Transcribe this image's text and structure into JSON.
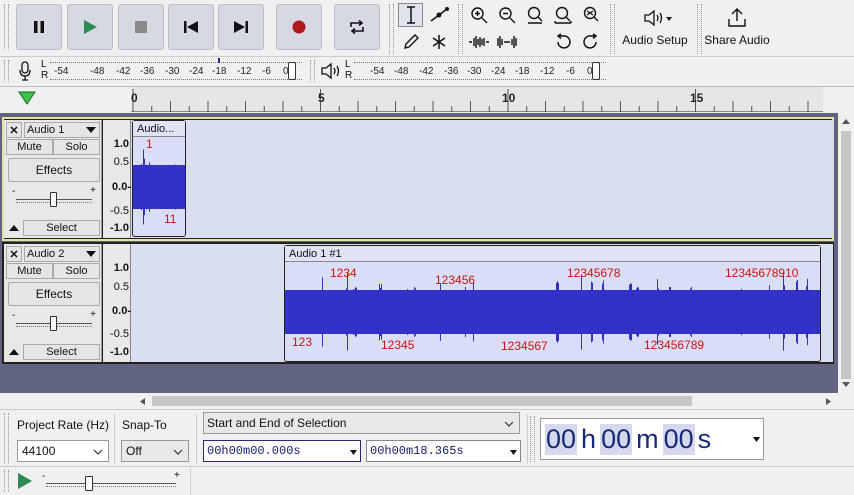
{
  "toolbar": {
    "transport": [
      {
        "name": "pause-button",
        "icon": "pause-icon"
      },
      {
        "name": "play-button",
        "icon": "play-icon"
      },
      {
        "name": "stop-button",
        "icon": "stop-icon"
      },
      {
        "name": "skip-start-button",
        "icon": "skip-start-icon"
      },
      {
        "name": "skip-end-button",
        "icon": "skip-end-icon"
      },
      {
        "name": "record-button",
        "icon": "record-icon"
      },
      {
        "name": "loop-button",
        "icon": "loop-icon"
      }
    ],
    "audio_setup_label": "Audio Setup",
    "share_audio_label": "Share Audio"
  },
  "meters": {
    "record_ticks": [
      "-54",
      "-48",
      "-42",
      "-36",
      "-30",
      "-24",
      "-18",
      "-12",
      "-6",
      "0"
    ],
    "play_ticks": [
      "-54",
      "-48",
      "-42",
      "-36",
      "-30",
      "-24",
      "-18",
      "-12",
      "-6",
      "0"
    ],
    "lr": [
      "L",
      "R"
    ]
  },
  "ruler": {
    "marks": [
      "0",
      "5",
      "10",
      "15"
    ]
  },
  "tracks": [
    {
      "name": "Audio 1",
      "mute": "Mute",
      "solo": "Solo",
      "effects": "Effects",
      "select": "Select",
      "scale": [
        "1.0",
        "0.5",
        "0.0-",
        "-0.5",
        "-1.0"
      ],
      "clip_title": "Audio...",
      "labels": [
        "1",
        "11"
      ]
    },
    {
      "name": "Audio 2",
      "mute": "Mute",
      "solo": "Solo",
      "effects": "Effects",
      "select": "Select",
      "scale": [
        "1.0",
        "0.5",
        "0.0-",
        "-0.5",
        "-1.0"
      ],
      "clip_title": "Audio 1 #1",
      "labels": [
        "1234",
        "123456",
        "12345678",
        "12345678910",
        "123",
        "12345",
        "1234567",
        "123456789"
      ]
    }
  ],
  "selection": {
    "project_rate_label": "Project Rate (Hz)",
    "project_rate_value": "44100",
    "snap_to_label": "Snap-To",
    "snap_to_value": "Off",
    "mode_value": "Start and End of Selection",
    "start_time": "00h00m00.000s",
    "end_time": "00h00m18.365s",
    "big_time": [
      "00",
      "h",
      "00",
      "m",
      "00",
      "s"
    ]
  },
  "colors": {
    "waveform": "#3232c8",
    "track_bg": "#d9def0",
    "label": "#d01010",
    "selected_border": "#e5e39a"
  }
}
